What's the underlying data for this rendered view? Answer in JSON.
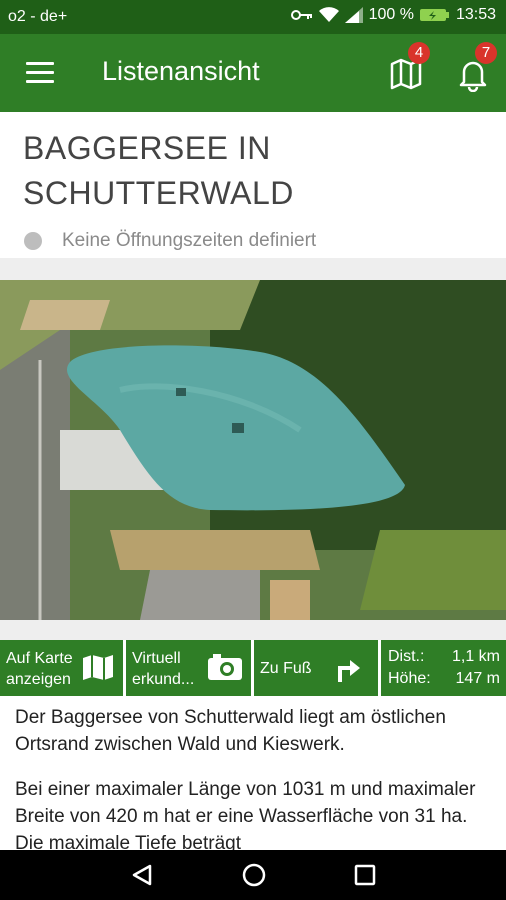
{
  "status": {
    "carrier": "o2 - de+",
    "battery": "100 %",
    "time": "13:53"
  },
  "appbar": {
    "title": "Listenansicht",
    "map_badge": "4",
    "bell_badge": "7"
  },
  "place": {
    "name": "BAGGERSEE IN SCHUTTERWALD",
    "opening": "Keine Öffnungszeiten definiert"
  },
  "actions": [
    {
      "label": "Auf Karte\nanzeigen",
      "icon": "map-icon"
    },
    {
      "label": "Virtuell\nerkund...",
      "icon": "camera-icon"
    },
    {
      "label": "Zu Fuß",
      "icon": "turn-right-arrow-icon"
    },
    {
      "dist_label": "Dist.:",
      "dist_value": "1,1 km",
      "height_label": "Höhe:",
      "height_value": "147 m"
    }
  ],
  "description": [
    "Der Baggersee von Schutterwald liegt am östlichen Ortsrand zwischen Wald und Kieswerk.",
    "Bei einer maximaler Länge von 1031 m und maximaler Breite von 420 m hat er eine Wasserfläche von 31 ha. Die maximale Tiefe beträgt"
  ]
}
